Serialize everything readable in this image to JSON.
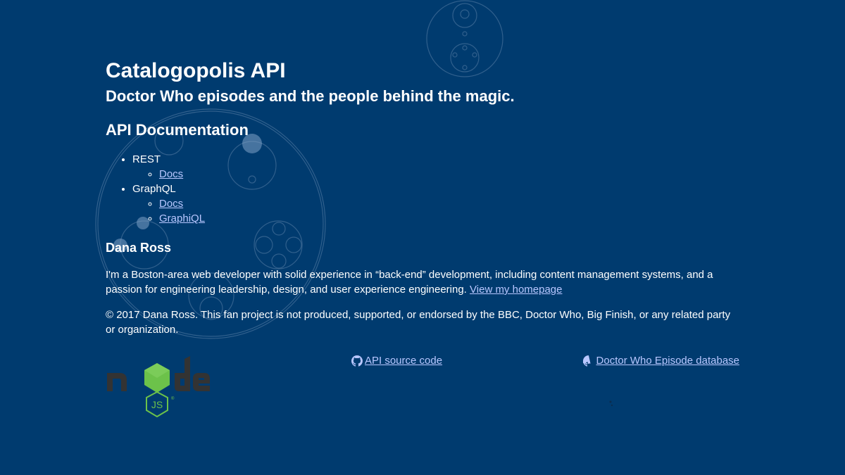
{
  "header": {
    "title": "Catalogopolis API",
    "subtitle": "Doctor Who episodes and the people behind the magic."
  },
  "docs": {
    "heading": "API Documentation",
    "items": [
      {
        "label": "REST",
        "links": [
          {
            "label": "Docs"
          }
        ]
      },
      {
        "label": "GraphQL",
        "links": [
          {
            "label": "Docs"
          },
          {
            "label": "GraphiQL"
          }
        ]
      }
    ]
  },
  "author": {
    "name": "Dana Ross",
    "bio": "I'm a Boston-area web developer with solid experience in “back-end” development, including content management systems, and a passion for engineering leadership, design, and user experience engineering.",
    "homepage_label": "View my homepage"
  },
  "copyright": "© 2017 Dana Ross. This fan project is not produced, supported, or endorsed by the BBC, Doctor Who, Big Finish, or any related party or organization.",
  "footer": {
    "api_source_label": "API source code",
    "episode_db_label": "Doctor Who Episode database"
  },
  "icons": {
    "github": "github-icon",
    "nodejs": "nodejs-logo"
  },
  "colors": {
    "background": "#003b6f",
    "link": "#b9c7ff",
    "text": "#ffffff",
    "node_green": "#6cc24a",
    "node_dark": "#333333"
  }
}
